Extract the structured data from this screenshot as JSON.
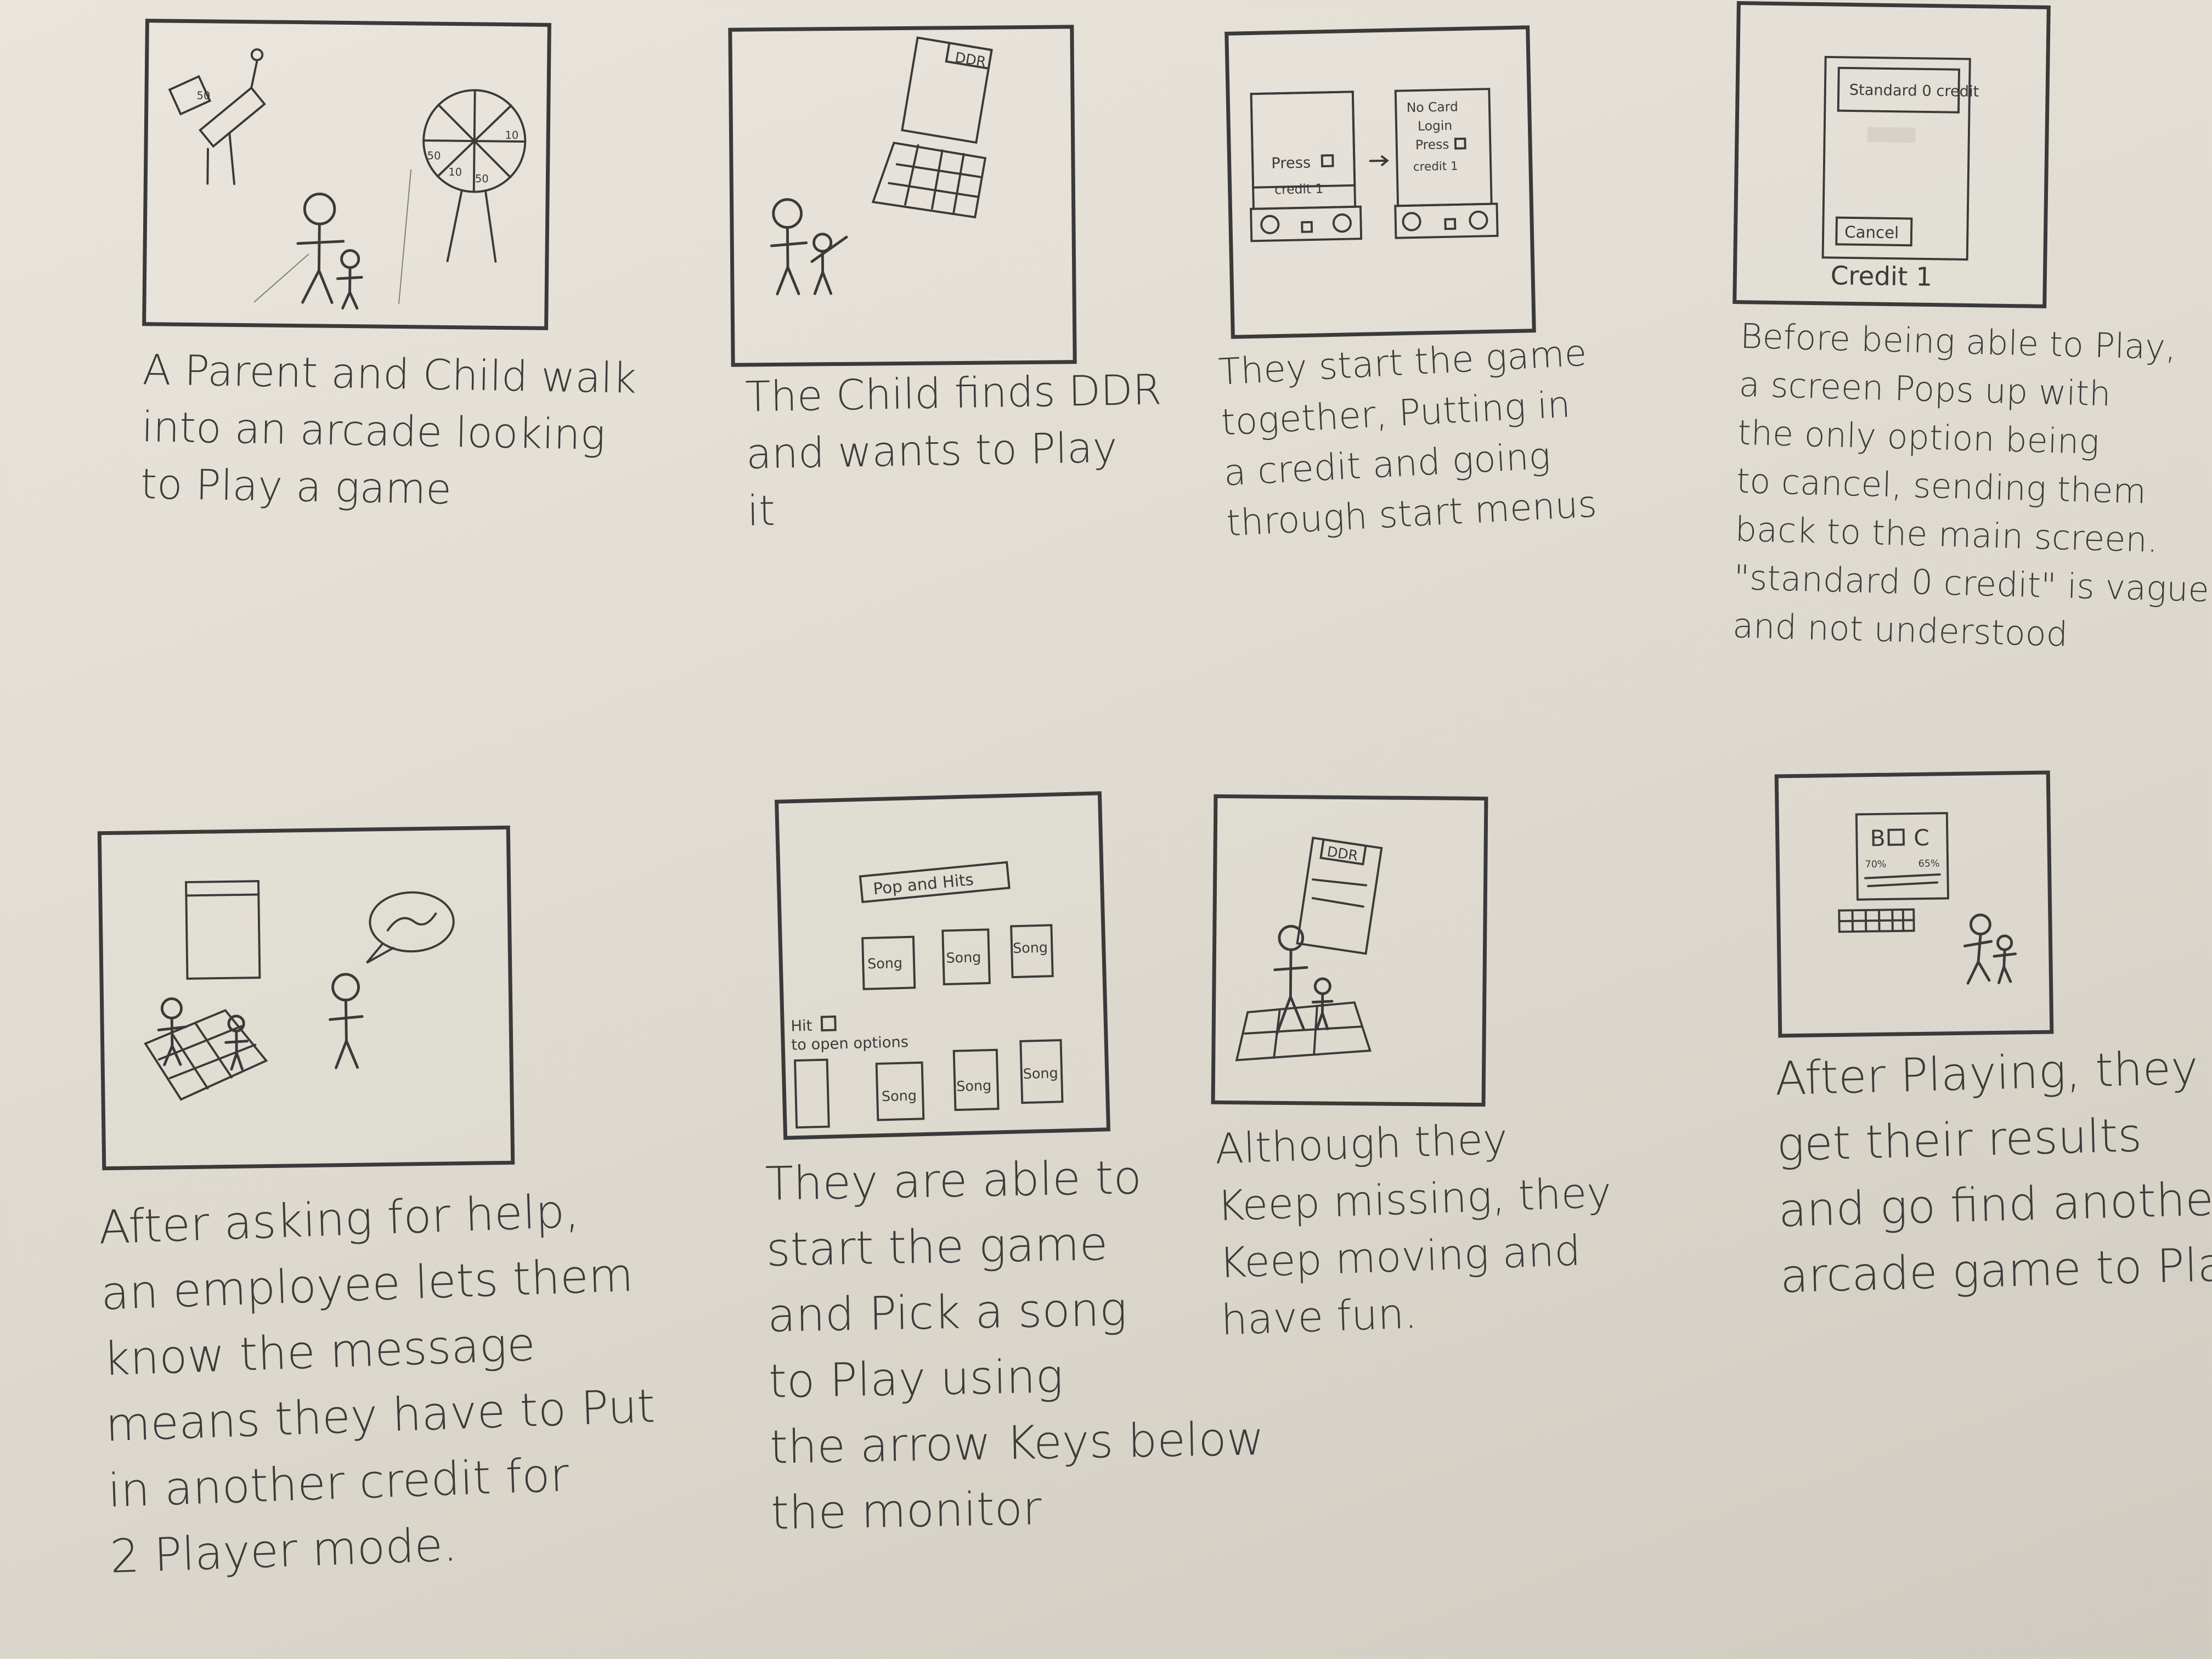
{
  "storyboard": {
    "panels": [
      {
        "id": 1,
        "sketch_labels": [
          "50",
          "50",
          "10",
          "10",
          "50"
        ],
        "caption": [
          "A Parent and Child walk",
          "into an arcade looking",
          "to Play a game"
        ]
      },
      {
        "id": 2,
        "sketch_labels": [
          "DDR"
        ],
        "caption": [
          "The Child finds DDR",
          "and wants to Play",
          "it"
        ]
      },
      {
        "id": 3,
        "sketch_labels": [
          "Press",
          "credit 1",
          "No Card",
          "Login",
          "Press",
          "credit 1"
        ],
        "caption": [
          "They start the game",
          "together, Putting in",
          "a credit and going",
          "through start menus"
        ]
      },
      {
        "id": 4,
        "sketch_labels": [
          "Standard 0 credit",
          "Cancel",
          "Credit 1"
        ],
        "caption": [
          "Before being able to Play,",
          "a screen Pops up with",
          "the only option being",
          "to cancel, sending them",
          "back to the main screen.",
          "\"standard 0 credit\" is vague",
          "and not understood"
        ]
      },
      {
        "id": 5,
        "sketch_labels": [],
        "caption": [
          "After asking for help,",
          "an employee lets them",
          "know the message",
          "means they have to Put",
          "in another credit for",
          "2 Player mode."
        ]
      },
      {
        "id": 6,
        "sketch_labels": [
          "Pop and Hits",
          "Song",
          "Song",
          "Song",
          "Hit",
          "to open options",
          "Song",
          "Song",
          "Song"
        ],
        "caption": [
          "They are able to",
          "start the game",
          "and Pick a song",
          "to Play using",
          "the arrow Keys below",
          "the monitor"
        ]
      },
      {
        "id": 7,
        "sketch_labels": [
          "DDR"
        ],
        "caption": [
          "Although they",
          "Keep missing, they",
          "Keep moving and",
          "have fun."
        ]
      },
      {
        "id": 8,
        "sketch_labels": [
          "B",
          "C",
          "70%",
          "65%"
        ],
        "caption": [
          "After Playing, they",
          "get their results",
          "and go find another",
          "arcade game to Play"
        ]
      }
    ]
  }
}
